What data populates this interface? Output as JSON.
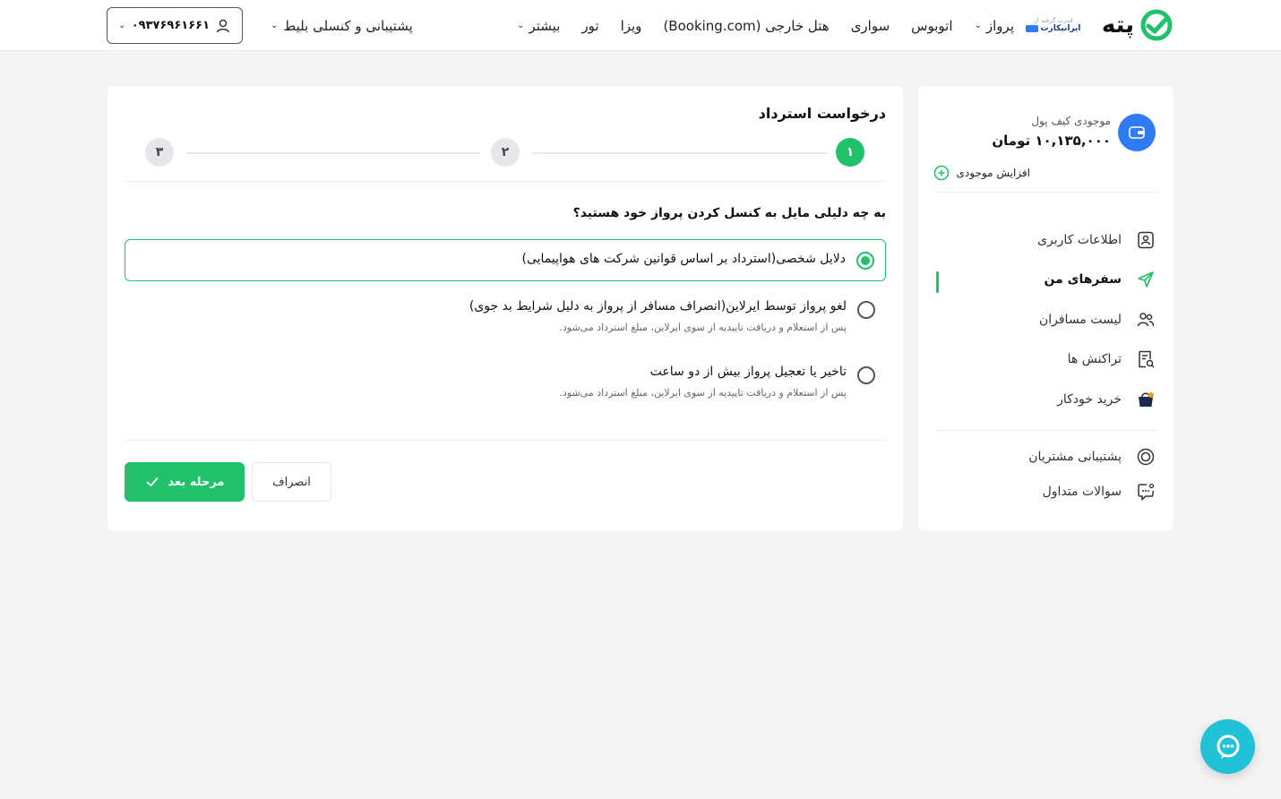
{
  "header": {
    "logo_text": "پته",
    "partner_small": "قدرت گرفته از",
    "partner_brand": "ایرانیکارت",
    "nav": [
      {
        "label": "پرواز",
        "has_dropdown": true
      },
      {
        "label": "اتوبوس",
        "has_dropdown": false
      },
      {
        "label": "سواری",
        "has_dropdown": false
      },
      {
        "label": "هتل خارجی (Booking.com)",
        "has_dropdown": false
      },
      {
        "label": "ویزا",
        "has_dropdown": false
      },
      {
        "label": "تور",
        "has_dropdown": false
      },
      {
        "label": "بیشتر",
        "has_dropdown": true
      }
    ],
    "support_link": "پشتیبانی و کنسلی بلیط",
    "account_phone": "۰۹۳۷۶۹۶۱۶۶۱"
  },
  "sidebar": {
    "wallet_label": "موجودی کیف پول",
    "wallet_amount": "۱۰,۱۳۵,۰۰۰ تومان",
    "add_balance": "افزایش موجودی",
    "menu": [
      {
        "label": "اطلاعات کاربری",
        "icon": "user-card-icon",
        "active": false
      },
      {
        "label": "سفرهای من",
        "icon": "paper-plane-icon",
        "active": true
      },
      {
        "label": "لیست مسافران",
        "icon": "users-icon",
        "active": false
      },
      {
        "label": "تراکنش ها",
        "icon": "receipt-search-icon",
        "active": false
      },
      {
        "label": "خرید خودکار",
        "icon": "auto-buy-icon",
        "active": false
      }
    ],
    "support_menu": [
      {
        "label": "پشتیبانی مشتریان",
        "icon": "lifebuoy-icon"
      },
      {
        "label": "سوالات متداول",
        "icon": "chat-question-icon"
      }
    ]
  },
  "main": {
    "title": "درخواست استرداد",
    "steps": [
      "۱",
      "۲",
      "۳"
    ],
    "current_step": 1,
    "question": "به چه دلیلی مایل به کنسل کردن پرواز خود هستید؟",
    "options": [
      {
        "title": "دلایل شخصی(استرداد بر اساس قوانین شرکت های هواپیمایی)",
        "desc": "",
        "selected": true
      },
      {
        "title": "لغو پرواز توسط ایرلاین(انصراف مسافر از پرواز به دلیل شرایط بد جوی)",
        "desc": "پس از استعلام و دریافت تاییدیه از سوی ایرلاین، مبلغ استرداد می‌شود.",
        "selected": false
      },
      {
        "title": "تاخیر یا تعجیل پرواز بیش از دو ساعت",
        "desc": "پس از استعلام و دریافت تاییدیه از سوی ایرلاین، مبلغ استرداد می‌شود.",
        "selected": false
      }
    ],
    "next_label": "مرحله بعد",
    "cancel_label": "انصراف"
  },
  "colors": {
    "accent": "#21c06a",
    "wallet_blue": "#2f7bf5",
    "chat": "#20c2d6"
  }
}
